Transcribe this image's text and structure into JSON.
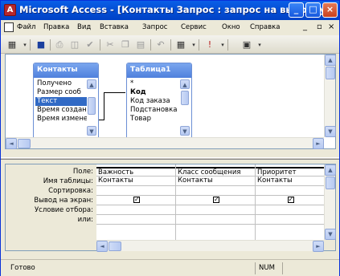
{
  "window": {
    "title": "Microsoft Access - [Контакты Запрос : запрос на выборку]",
    "minimize_glyph": "_",
    "maximize_glyph": "□",
    "close_glyph": "×"
  },
  "menu": {
    "items": [
      "Файл",
      "Правка",
      "Вид",
      "Вставка",
      "Запрос",
      "Сервис",
      "Окно",
      "Справка"
    ],
    "mdi_minimize": "_",
    "mdi_restore": "▫",
    "mdi_close": "×"
  },
  "toolbar": {
    "icons": [
      "view-icon",
      "save-icon",
      "print-icon",
      "print-preview-icon",
      "spelling-icon",
      "cut-icon",
      "copy-icon",
      "paste-icon",
      "undo-icon",
      "query-type-icon",
      "run-icon"
    ]
  },
  "tables": [
    {
      "title": "Контакты",
      "fields": [
        "Получено",
        "Размер сооб",
        "Текст",
        "Время создан",
        "Время изменен"
      ],
      "selected_index": 2
    },
    {
      "title": "Таблица1",
      "fields": [
        "*",
        "Код",
        "Код заказа",
        "Подстановка",
        "Товар"
      ],
      "bold_index": 1
    }
  ],
  "grid": {
    "row_labels": [
      "Поле:",
      "Имя таблицы:",
      "Сортировка:",
      "Вывод на экран:",
      "Условие отбора:",
      "или:"
    ],
    "columns": [
      {
        "field": "Важность",
        "table": "Контакты",
        "show": true
      },
      {
        "field": "Класс сообщения",
        "table": "Контакты",
        "show": true
      },
      {
        "field": "Приоритет",
        "table": "Контакты",
        "show": true
      }
    ],
    "check_glyph": "✓"
  },
  "status": {
    "text": "Готово",
    "num_indicator": "NUM"
  },
  "colors": {
    "titlebar": "#0551d6",
    "selection": "#316ac5",
    "table_header": "#4f80dd"
  }
}
